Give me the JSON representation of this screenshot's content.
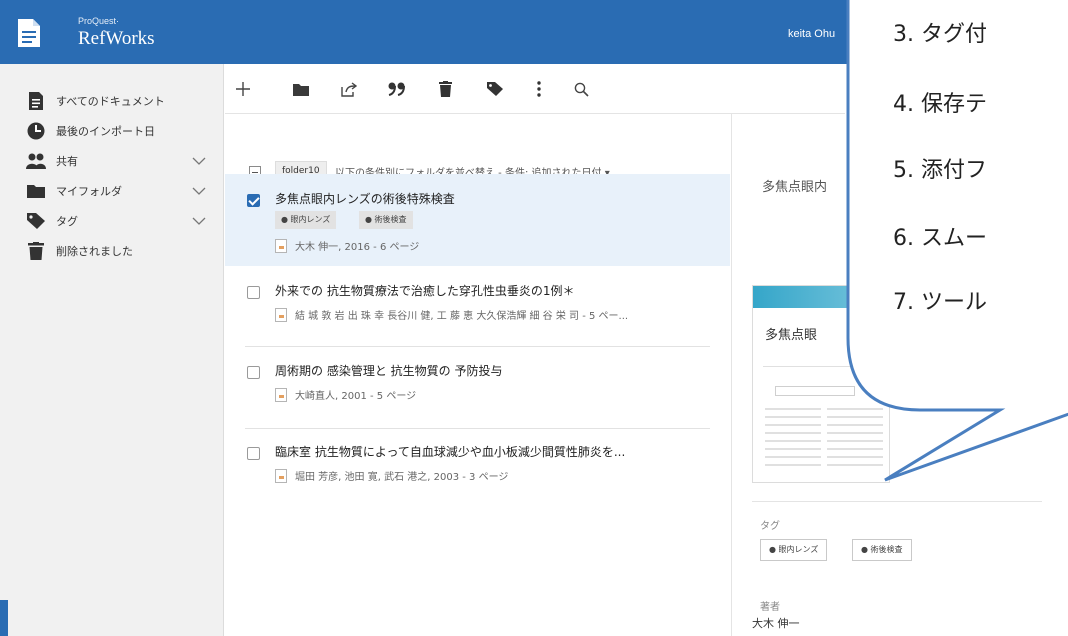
{
  "app": {
    "brand_small": "ProQuest·",
    "brand_name": "RefWorks",
    "user_name": "keita Ohu"
  },
  "sidebar": {
    "items": [
      {
        "label": "すべてのドキュメント",
        "icon": "document-icon"
      },
      {
        "label": "最後のインポート日",
        "icon": "clock-icon"
      },
      {
        "label": "共有",
        "icon": "users-icon"
      },
      {
        "label": "マイフォルダ",
        "icon": "folder-icon"
      },
      {
        "label": "タグ",
        "icon": "tag-icon"
      },
      {
        "label": "削除されました",
        "icon": "trash-icon"
      }
    ]
  },
  "toolbar": {
    "icons": [
      "add-icon",
      "folder-icon",
      "share-icon",
      "quote-icon",
      "trash-icon",
      "tag-icon",
      "more-icon",
      "search-icon"
    ]
  },
  "list": {
    "folder_chip": "folder10",
    "sort_text": "以下の条件別にフォルダを並べ替え - 条件: 追加された日付 ▾",
    "documents": [
      {
        "title": "多焦点眼内レンズの術後特殊検査",
        "tags": [
          "眼内レンズ",
          "術後検査"
        ],
        "meta": "大木 伸一, 2016 - 6 ページ",
        "selected": true
      },
      {
        "title": "外来での 抗生物質療法で治癒した穿孔性虫垂炎の1例＊",
        "tags": [],
        "meta": "結 城 敦 岩 出 珠 幸 長谷川 健, 工 藤 恵 大久保浩輝 細 谷 栄 司 - 5 ペー...",
        "selected": false
      },
      {
        "title": "周術期の 感染管理と 抗生物質の 予防投与",
        "tags": [],
        "meta": "大崎直人, 2001 - 5 ページ",
        "selected": false
      },
      {
        "title": "臨床室 抗生物質によって自血球減少や血小板減少間質性肺炎を...",
        "tags": [],
        "meta": "堀田 芳彦, 池田 寛, 武石 港之, 2003 - 3 ページ",
        "selected": false
      }
    ]
  },
  "detail": {
    "title": "多焦点眼内",
    "thumb_title": "多焦点眼",
    "tags_label": "タグ",
    "tags": [
      "眼内レンズ",
      "術後検査"
    ],
    "authors_label": "著者",
    "author": "大木 伸一"
  },
  "callout": {
    "lines": [
      "3.  タグ付",
      "4.  保存テ",
      "5.  添付フ",
      "6.  スムー",
      "7.  ツール"
    ]
  },
  "colors": {
    "topbar": "#2a6cb3",
    "callout_border": "#4a7fc0"
  }
}
